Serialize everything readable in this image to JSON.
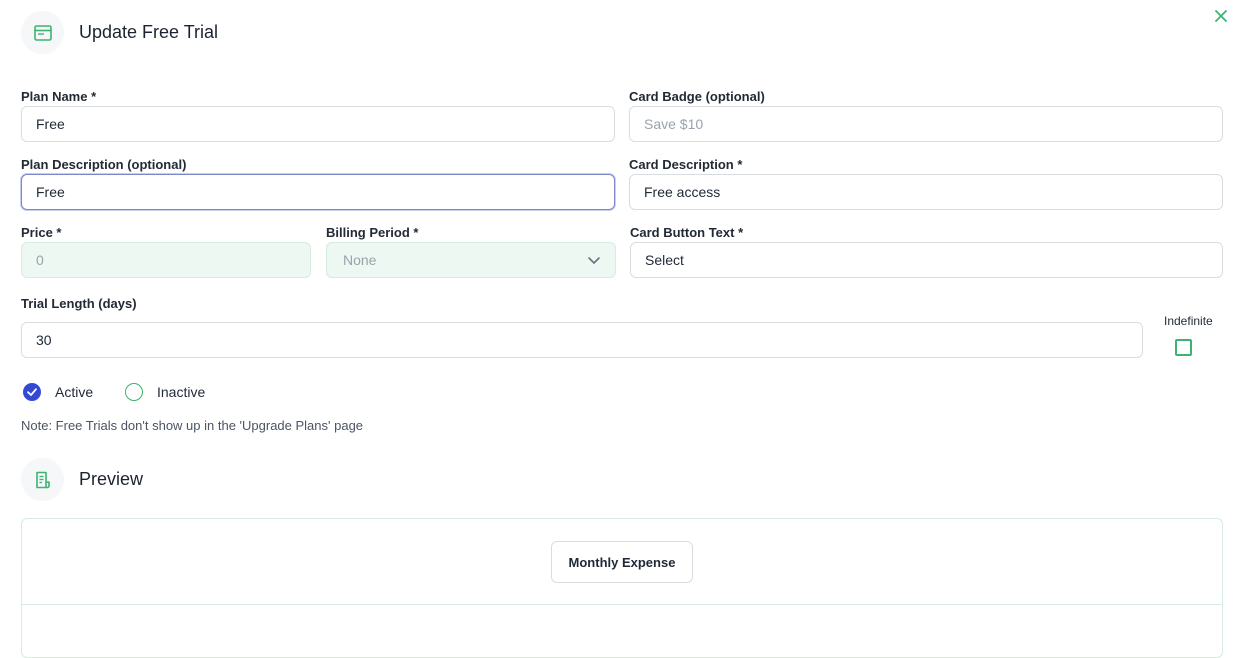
{
  "header": {
    "title": "Update Free Trial",
    "icon": "window-icon"
  },
  "colors": {
    "accent": "#3cb371",
    "active_radio": "#3349d6",
    "disabled_bg": "#ecf8f1"
  },
  "form": {
    "plan_name": {
      "label": "Plan Name *",
      "value": "Free"
    },
    "card_badge": {
      "label": "Card Badge (optional)",
      "value": "",
      "placeholder": "Save $10"
    },
    "plan_description": {
      "label": "Plan Description (optional)",
      "value": "Free"
    },
    "card_description": {
      "label": "Card Description *",
      "value": "Free access"
    },
    "price": {
      "label": "Price *",
      "value": "",
      "placeholder": "0"
    },
    "billing_period": {
      "label": "Billing Period *",
      "value": "None"
    },
    "card_button_text": {
      "label": "Card Button Text *",
      "value": "Select"
    },
    "trial_length": {
      "label": "Trial Length (days)",
      "value": "30"
    },
    "indefinite": {
      "label": "Indefinite",
      "checked": false
    },
    "status": {
      "active_label": "Active",
      "inactive_label": "Inactive",
      "selected": "active"
    },
    "note": "Note: Free Trials don't show up in the 'Upgrade Plans' page"
  },
  "preview": {
    "title": "Preview",
    "icon": "document-icon",
    "card_button": "Monthly Expense"
  }
}
